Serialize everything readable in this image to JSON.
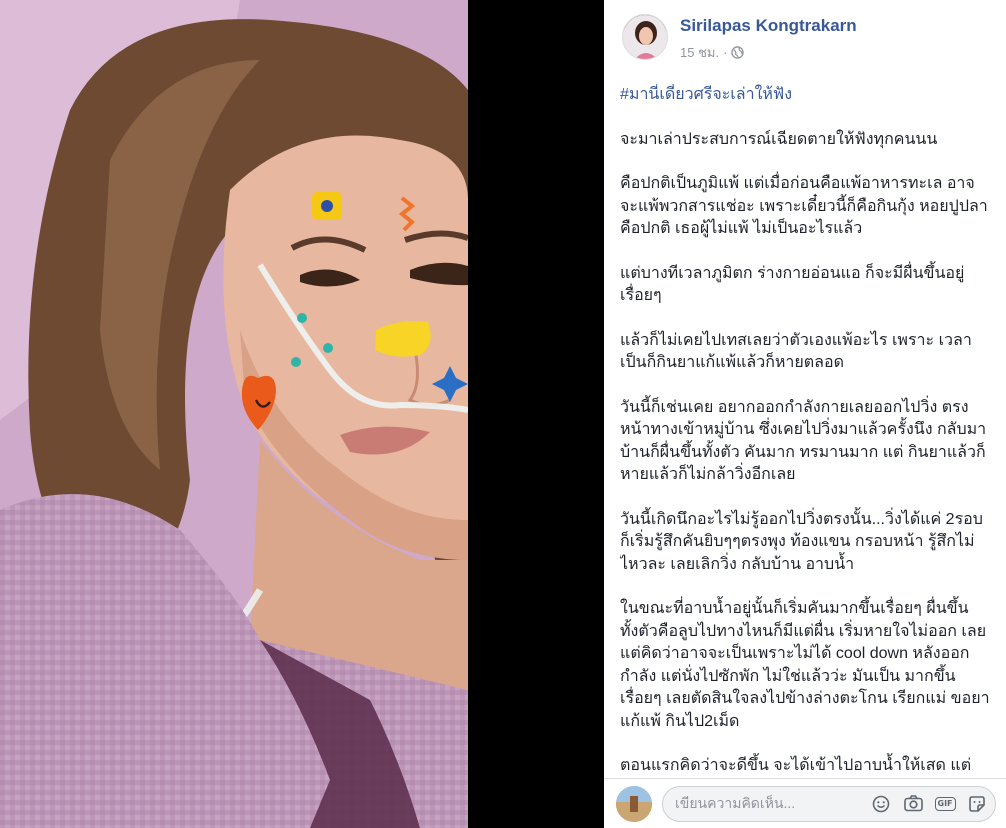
{
  "post": {
    "author": "Sirilapas Kongtrakarn",
    "time": "15 ชม.",
    "separator": "·",
    "privacy_icon": "globe-icon",
    "hashtag": "#มานี่เดี๋ยวศรีจะเล่าให้ฟัง",
    "paragraphs": [
      "จะมาเล่าประสบการณ์เฉียดตายให้ฟังทุกคนนน",
      "คือปกติเป็นภูมิแพ้ แต่เมื่อก่อนคือแพ้อาหารทะเล อาจจะแพ้พวกสารแช่อะ เพราะเดี๋ยวนี้ก็คือกินกุ้ง หอยปูปลาคือปกติ เธอผู้ไม่แพ้ ไม่เป็นอะไรแล้ว",
      "แต่บางทีเวลาภูมิตก ร่างกายอ่อนแอ ก็จะมีผื่นขึ้นอยู่ เรื่อยๆ",
      "แล้วก็ไม่เคยไปเทสเลยว่าตัวเองแพ้อะไร เพราะ เวลาเป็นก็กินยาแก้แพ้แล้วก็หายตลอด",
      "วันนี้ก็เช่นเคย อยากออกกำลังกายเลยออกไปวิ่ง ตรงหน้าทางเข้าหมู่บ้าน ซึ่งเคยไปวิ่งมาแล้วครั้งนึง กลับมาบ้านก็ผื่นขึ้นทั้งตัว คันมาก ทรมานมาก แต่ กินยาแล้วก็หายแล้วก็ไม่กล้าวิ่งอีกเลย",
      "วันนี้เกิดนึกอะไรไม่รู้ออกไปวิ่งตรงนั้น...วิ่งได้แค่ 2รอบก็เริ่มรู้สึกคันยิบๆๆตรงพุง ท้องแขน กรอบหน้า รู้สึกไม่ไหวละ เลยเลิกวิ่ง กลับบ้าน อาบน้ำ",
      "ในขณะที่อาบน้ำอยู่นั้นก็เริ่มคันมากขึ้นเรื่อยๆ ผื่นขึ้น ทั้งตัวคือลูบไปทางไหนก็มีแต่ผื่น เริ่มหายใจไม่ออก เลย แต่คิดว่าอาจจะเป็นเพราะไม่ได้ cool down หลังออกกำลัง แต่นั่งไปซักพัก ไม่ใช่แล้วว่ะ มันเป็น มากขึ้นเรื่อยๆ เลยตัดสินใจลงไปข้างล่างตะโกน เรียกแม่ ขอยาแก้แพ้ กินไป2เม็ด",
      "ตอนแรกคิดว่าจะดีขึ้น จะได้เข้าไปอาบน้ำให้เสด แต่ ไม่ว่าเลย"
    ]
  },
  "comment_bar": {
    "placeholder": "เขียนความคิดเห็น...",
    "icons": [
      "smiley-icon",
      "camera-icon",
      "gif-icon",
      "sticker-icon"
    ],
    "gif_label": "GIF"
  },
  "colors": {
    "author": "#385898",
    "hashtag": "#385898",
    "text": "#1d2129",
    "meta": "#90949c"
  }
}
